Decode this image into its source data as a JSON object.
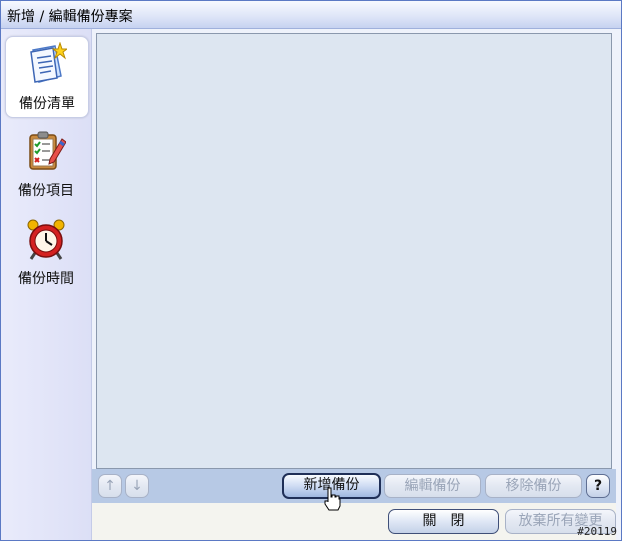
{
  "window": {
    "title": "新增 / 編輯備份專案"
  },
  "sidebar": {
    "items": [
      {
        "label": "備份清單",
        "icon": "document-list-icon",
        "active": true
      },
      {
        "label": "備份項目",
        "icon": "clipboard-checklist-icon",
        "active": false
      },
      {
        "label": "備份時間",
        "icon": "alarm-clock-icon",
        "active": false
      }
    ]
  },
  "toolbar": {
    "up": "↑",
    "down": "↓",
    "add": "新增備份",
    "edit": "編輯備份",
    "remove": "移除備份",
    "help": "?"
  },
  "footer": {
    "close": "關　閉",
    "discard": "放棄所有變更"
  },
  "watermark": "#20119",
  "colors": {
    "accent": "#5b79c4",
    "panel": "#dde6f1",
    "toolbar": "#b7c9e5"
  }
}
